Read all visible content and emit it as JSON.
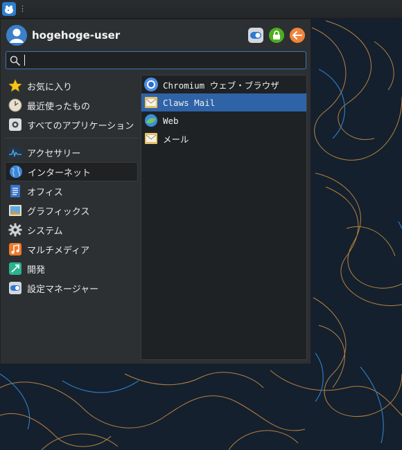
{
  "user": {
    "name": "hogehoge-user"
  },
  "actions": [
    {
      "name": "settings-toggle-icon",
      "color": "#d8dde3"
    },
    {
      "name": "lock-icon",
      "color": "#4caf1d"
    },
    {
      "name": "logout-icon",
      "color": "#f0843a"
    }
  ],
  "search": {
    "value": "",
    "placeholder": ""
  },
  "categories": {
    "favorites": "お気に入り",
    "recent": "最近使ったもの",
    "all": "すべてのアプリケーション",
    "accessories": "アクセサリー",
    "internet": "インターネット",
    "office": "オフィス",
    "graphics": "グラフィックス",
    "system": "システム",
    "multimedia": "マルチメディア",
    "development": "開発",
    "settings": "設定マネージャー"
  },
  "apps": {
    "chromium": "Chromium ウェブ・ブラウザ",
    "claws": "Claws Mail",
    "web": "Web",
    "mail": "メール"
  },
  "colors": {
    "accent": "#2f63a8",
    "desktop": "#14202e",
    "contour_orange": "#c8873f",
    "contour_blue": "#3a86c8"
  }
}
